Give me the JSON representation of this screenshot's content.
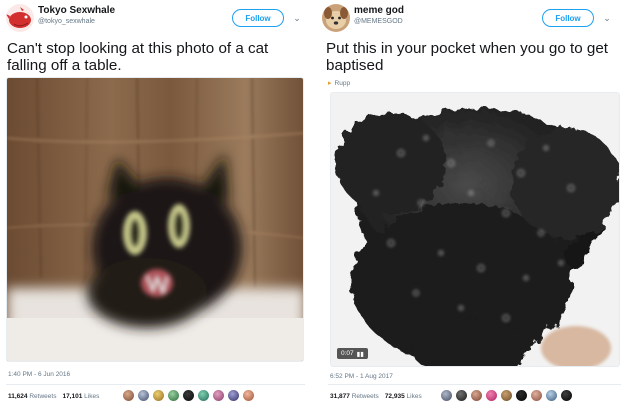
{
  "tweets": [
    {
      "name": "Tokyo Sexwhale",
      "handle": "@tokyo_sexwhale",
      "follow_label": "Follow",
      "text": "Can't stop looking at this photo of a cat falling off a table.",
      "timestamp": "1:40 PM - 6 Jun 2016",
      "retweets_count": "11,624",
      "retweets_label": "Retweets",
      "likes_count": "17,101",
      "likes_label": "Likes",
      "avatar_icon": "red-whale-avatar",
      "media": "blurred-black-cat-photo"
    },
    {
      "name": "meme god",
      "handle": "@MEMESGOD",
      "follow_label": "Follow",
      "text": "Put this in your pocket when you go to get baptised",
      "credit": "Rupp",
      "timestamp": "6:52 PM - 1 Aug 2017",
      "retweets_count": "31,877",
      "retweets_label": "Retweets",
      "likes_count": "72,935",
      "likes_label": "Likes",
      "gif_duration": "0:07",
      "avatar_icon": "dog-avatar",
      "media": "black-fluffy-animal-underwater-photo"
    }
  ],
  "colors": {
    "accent": "#1da1f2",
    "secondary_text": "#657786",
    "primary_text": "#14171a"
  }
}
